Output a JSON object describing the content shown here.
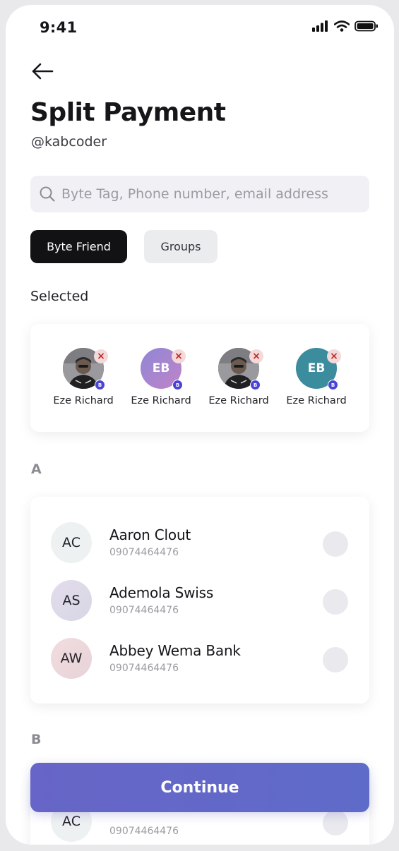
{
  "status": {
    "time": "9:41"
  },
  "header": {
    "title": "Split Payment",
    "handle": "@kabcoder"
  },
  "search": {
    "placeholder": "Byte Tag, Phone number, email address",
    "value": ""
  },
  "tabs": [
    {
      "label": "Byte Friend",
      "active": true
    },
    {
      "label": "Groups",
      "active": false
    }
  ],
  "selected": {
    "title": "Selected",
    "items": [
      {
        "name": "Eze Richard",
        "initials": "",
        "avatar": "photo",
        "badge": "B",
        "remove": "×"
      },
      {
        "name": "Eze Richard",
        "initials": "EB",
        "avatar": "purple",
        "badge": "B",
        "remove": "×"
      },
      {
        "name": "Eze Richard",
        "initials": "",
        "avatar": "photo",
        "badge": "B",
        "remove": "×"
      },
      {
        "name": "Eze Richard",
        "initials": "EB",
        "avatar": "teal",
        "badge": "B",
        "remove": "×"
      }
    ]
  },
  "sections": [
    {
      "letter": "A",
      "contacts": [
        {
          "initials": "AC",
          "name": "Aaron Clout",
          "phone": "09074464476"
        },
        {
          "initials": "AS",
          "name": "Ademola Swiss",
          "phone": "09074464476"
        },
        {
          "initials": "AW",
          "name": "Abbey Wema Bank",
          "phone": "09074464476"
        }
      ]
    },
    {
      "letter": "B",
      "contacts": [
        {
          "initials": "AC",
          "name": "",
          "phone": "09074464476"
        }
      ]
    }
  ],
  "footer": {
    "continue_label": "Continue"
  },
  "colors": {
    "primary_button": "#6566c7",
    "active_tab": "#121214",
    "badge": "#4a44d6",
    "remove": "#c22a2a",
    "avatar_purple": "#a17fd0",
    "avatar_teal": "#3b8c9c"
  }
}
